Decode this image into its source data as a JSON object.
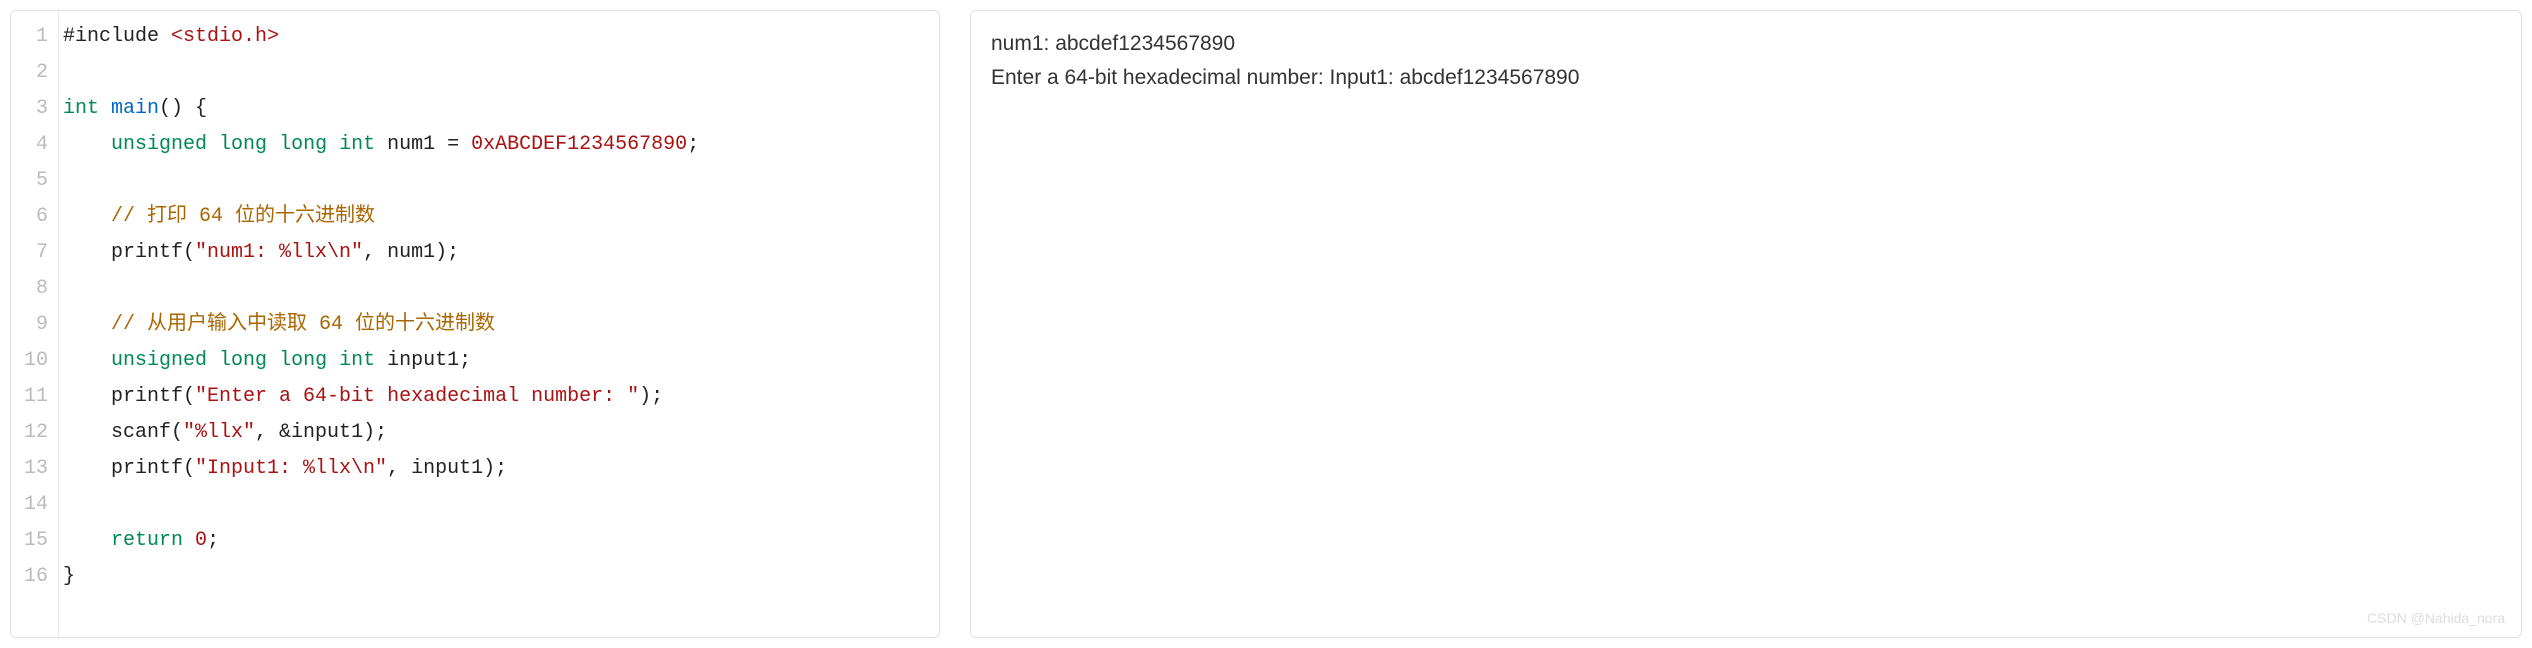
{
  "code": {
    "lines": [
      {
        "n": "1",
        "segments": [
          {
            "cls": "plain",
            "t": "#include "
          },
          {
            "cls": "str",
            "t": "<stdio.h>"
          }
        ]
      },
      {
        "n": "2",
        "segments": []
      },
      {
        "n": "3",
        "segments": [
          {
            "cls": "kw-type",
            "t": "int"
          },
          {
            "cls": "plain",
            "t": " "
          },
          {
            "cls": "kw-func",
            "t": "main"
          },
          {
            "cls": "plain",
            "t": "() {"
          }
        ]
      },
      {
        "n": "4",
        "segments": [
          {
            "cls": "plain",
            "t": "    "
          },
          {
            "cls": "kw-type",
            "t": "unsigned"
          },
          {
            "cls": "plain",
            "t": " "
          },
          {
            "cls": "kw-type",
            "t": "long"
          },
          {
            "cls": "plain",
            "t": " "
          },
          {
            "cls": "kw-type",
            "t": "long"
          },
          {
            "cls": "plain",
            "t": " "
          },
          {
            "cls": "kw-type",
            "t": "int"
          },
          {
            "cls": "plain",
            "t": " num1 = "
          },
          {
            "cls": "num",
            "t": "0xABCDEF1234567890"
          },
          {
            "cls": "plain",
            "t": ";"
          }
        ]
      },
      {
        "n": "5",
        "segments": []
      },
      {
        "n": "6",
        "segments": [
          {
            "cls": "plain",
            "t": "    "
          },
          {
            "cls": "comment",
            "t": "// 打印 64 位的十六进制数"
          }
        ]
      },
      {
        "n": "7",
        "segments": [
          {
            "cls": "plain",
            "t": "    printf("
          },
          {
            "cls": "str",
            "t": "\"num1: %llx\\n\""
          },
          {
            "cls": "plain",
            "t": ", num1);"
          }
        ]
      },
      {
        "n": "8",
        "segments": []
      },
      {
        "n": "9",
        "segments": [
          {
            "cls": "plain",
            "t": "    "
          },
          {
            "cls": "comment",
            "t": "// 从用户输入中读取 64 位的十六进制数"
          }
        ]
      },
      {
        "n": "10",
        "segments": [
          {
            "cls": "plain",
            "t": "    "
          },
          {
            "cls": "kw-type",
            "t": "unsigned"
          },
          {
            "cls": "plain",
            "t": " "
          },
          {
            "cls": "kw-type",
            "t": "long"
          },
          {
            "cls": "plain",
            "t": " "
          },
          {
            "cls": "kw-type",
            "t": "long"
          },
          {
            "cls": "plain",
            "t": " "
          },
          {
            "cls": "kw-type",
            "t": "int"
          },
          {
            "cls": "plain",
            "t": " input1;"
          }
        ]
      },
      {
        "n": "11",
        "segments": [
          {
            "cls": "plain",
            "t": "    printf("
          },
          {
            "cls": "str",
            "t": "\"Enter a 64-bit hexadecimal number: \""
          },
          {
            "cls": "plain",
            "t": ");"
          }
        ]
      },
      {
        "n": "12",
        "segments": [
          {
            "cls": "plain",
            "t": "    scanf("
          },
          {
            "cls": "str",
            "t": "\"%llx\""
          },
          {
            "cls": "plain",
            "t": ", &input1);"
          }
        ]
      },
      {
        "n": "13",
        "segments": [
          {
            "cls": "plain",
            "t": "    printf("
          },
          {
            "cls": "str",
            "t": "\"Input1: %llx\\n\""
          },
          {
            "cls": "plain",
            "t": ", input1);"
          }
        ]
      },
      {
        "n": "14",
        "segments": []
      },
      {
        "n": "15",
        "segments": [
          {
            "cls": "plain",
            "t": "    "
          },
          {
            "cls": "kw-keyword",
            "t": "return"
          },
          {
            "cls": "plain",
            "t": " "
          },
          {
            "cls": "num",
            "t": "0"
          },
          {
            "cls": "plain",
            "t": ";"
          }
        ]
      },
      {
        "n": "16",
        "segments": [
          {
            "cls": "plain",
            "t": "}"
          }
        ]
      }
    ]
  },
  "output": {
    "lines": [
      "num1: abcdef1234567890",
      "Enter a 64-bit hexadecimal number: Input1: abcdef1234567890"
    ]
  },
  "watermark": "CSDN @Nahida_nora"
}
